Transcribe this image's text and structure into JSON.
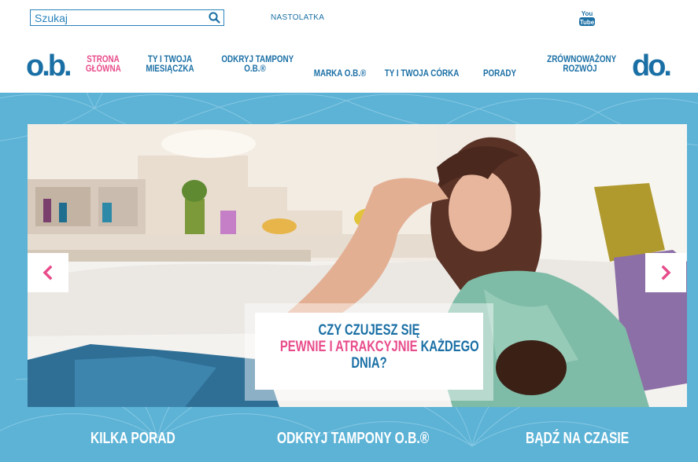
{
  "search": {
    "placeholder": "Szukaj",
    "value": ""
  },
  "top_links": {
    "teen": "NASTOLATKA",
    "youtube_line1": "You",
    "youtube_line2": "Tube"
  },
  "logos": {
    "left": "o.b.",
    "right": "do."
  },
  "nav": {
    "items": [
      {
        "line1": "STRONA",
        "line2": "GŁÓWNA",
        "active": true
      },
      {
        "line1": "TY I TWOJA",
        "line2": "MIESIĄCZKA",
        "active": false
      },
      {
        "line1": "ODKRYJ TAMPONY",
        "line2": "O.B.®",
        "active": false
      },
      {
        "line1": "MARKA O.B.®",
        "line2": "",
        "active": false
      },
      {
        "line1": "TY I TWOJA CÓRKA",
        "line2": "",
        "active": false
      },
      {
        "line1": "PORADY",
        "line2": "",
        "active": false
      },
      {
        "line1": "ZRÓWNOWAŻONY",
        "line2": "ROZWÓJ",
        "active": false
      }
    ]
  },
  "slider": {
    "caption_line1": "CZY CZUJESZ SIĘ",
    "caption_line2_pink": "PEWNIE I ATRAKCYJNIE",
    "caption_line2_rest": " KAŻDEGO",
    "caption_line3": "DNIA?",
    "prev_icon": "chevron-left-icon",
    "next_icon": "chevron-right-icon"
  },
  "bottom_links": [
    "KILKA PORAD",
    "ODKRYJ TAMPONY O.B.®",
    "BĄDŹ NA CZASIE"
  ],
  "colors": {
    "brand_blue": "#1a6fa5",
    "accent_pink": "#e84c8b",
    "band_blue": "#5cb3d6"
  }
}
